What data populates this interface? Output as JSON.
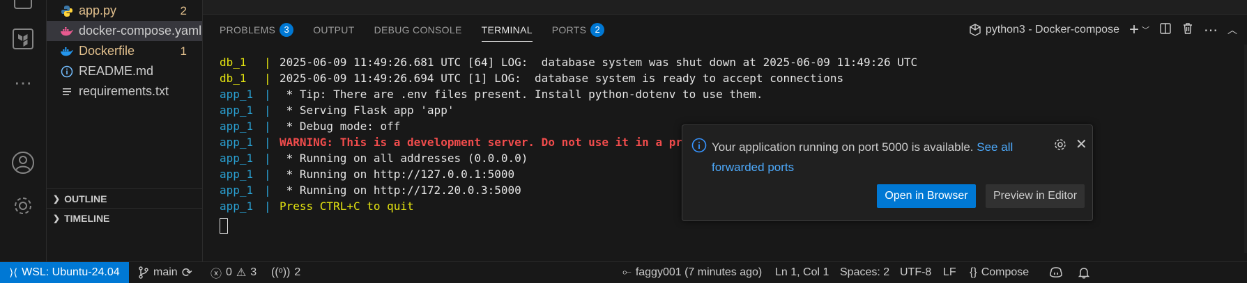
{
  "explorer": {
    "files": [
      {
        "name": "app.py",
        "icon": "python-file-icon",
        "badge": "2",
        "modified": true
      },
      {
        "name": "docker-compose.yaml",
        "icon": "docker-compose-icon",
        "badge": "",
        "modified": false,
        "selected": true
      },
      {
        "name": "Dockerfile",
        "icon": "docker-icon",
        "badge": "1",
        "modified": true
      },
      {
        "name": "README.md",
        "icon": "info-icon",
        "badge": "",
        "modified": false
      },
      {
        "name": "requirements.txt",
        "icon": "text-file-icon",
        "badge": "",
        "modified": false
      }
    ],
    "outline_label": "OUTLINE",
    "timeline_label": "TIMELINE"
  },
  "panel": {
    "tabs": [
      {
        "label": "PROBLEMS",
        "count": "3"
      },
      {
        "label": "OUTPUT",
        "count": ""
      },
      {
        "label": "DEBUG CONSOLE",
        "count": ""
      },
      {
        "label": "TERMINAL",
        "count": "",
        "active": true
      },
      {
        "label": "PORTS",
        "count": "2"
      }
    ],
    "terminal_name": "python3 - Docker-compose"
  },
  "terminal": {
    "lines": [
      {
        "svc": "db_1",
        "kind": "db",
        "text": "2025-06-09 11:49:26.681 UTC [64] LOG:  database system was shut down at 2025-06-09 11:49:26 UTC"
      },
      {
        "svc": "db_1",
        "kind": "db",
        "text": "2025-06-09 11:49:26.694 UTC [1] LOG:  database system is ready to accept connections"
      },
      {
        "svc": "app_1",
        "kind": "app",
        "text": " * Tip: There are .env files present. Install python-dotenv to use them."
      },
      {
        "svc": "app_1",
        "kind": "app",
        "text": " * Serving Flask app 'app'"
      },
      {
        "svc": "app_1",
        "kind": "app",
        "text": " * Debug mode: off"
      },
      {
        "svc": "app_1",
        "kind": "app",
        "style": "warn",
        "text": "WARNING: This is a development server. Do not use it in a pr"
      },
      {
        "svc": "app_1",
        "kind": "app",
        "text": " * Running on all addresses (0.0.0.0)"
      },
      {
        "svc": "app_1",
        "kind": "app",
        "text": " * Running on http://127.0.0.1:5000"
      },
      {
        "svc": "app_1",
        "kind": "app",
        "text": " * Running on http://172.20.0.3:5000"
      },
      {
        "svc": "app_1",
        "kind": "app",
        "style": "quit",
        "text": "Press CTRL+C to quit"
      }
    ]
  },
  "notification": {
    "message": "Your application running on port 5000 is available.",
    "link_part1": "See all",
    "link_part2": "forwarded ports",
    "primary_button": "Open in Browser",
    "secondary_button": "Preview in Editor"
  },
  "statusbar": {
    "remote": "WSL: Ubuntu-24.04",
    "branch": "main",
    "errors": "0",
    "warnings": "3",
    "ports": "2",
    "blame": "faggy001 (7 minutes ago)",
    "position": "Ln 1, Col 1",
    "spaces": "Spaces: 2",
    "encoding": "UTF-8",
    "eol": "LF",
    "language": "Compose"
  },
  "colors": {
    "accent": "#0078d4",
    "db_service": "#e5e510",
    "app_service": "#2aa1d3",
    "warning_text": "#f14c4c",
    "modified": "#e2c08d"
  }
}
